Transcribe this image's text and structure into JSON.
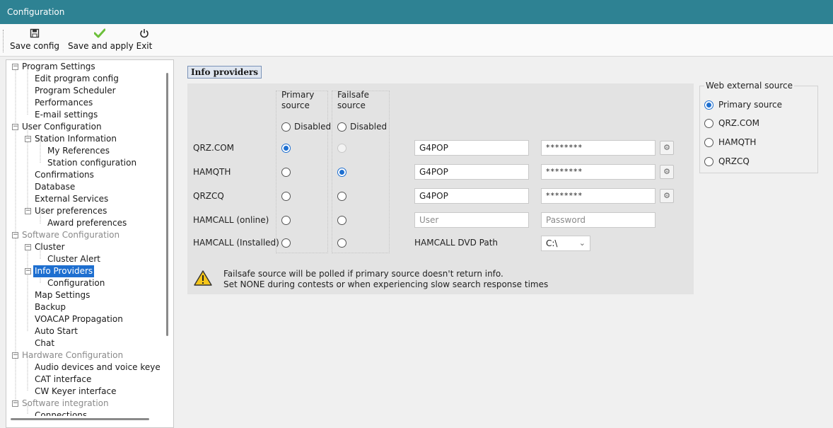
{
  "window": {
    "title": "Configuration"
  },
  "toolbar": {
    "save_config": "Save config",
    "save_apply": "Save and apply",
    "exit": "Exit",
    "save_icon": "floppy-icon",
    "apply_icon": "checkmark-icon",
    "exit_icon": "power-icon"
  },
  "tree": {
    "n0": "Program Settings",
    "n1": "Edit program config",
    "n2": "Program Scheduler",
    "n3": "Performances",
    "n4": "E-mail settings",
    "n5": "User Configuration",
    "n6": "Station Information",
    "n7": "My References",
    "n8": "Station configuration",
    "n9": "Confirmations",
    "n10": "Database",
    "n11": "External Services",
    "n12": "User preferences",
    "n13": "Award preferences",
    "n14": "Software Configuration",
    "n15": "Cluster",
    "n16": "Cluster Alert",
    "n17": "Info Providers",
    "n18": "Configuration",
    "n19": "Map Settings",
    "n20": "Backup",
    "n21": "VOACAP Propagation",
    "n22": "Auto Start",
    "n23": "Chat",
    "n24": "Hardware Configuration",
    "n25": "Audio devices and voice keye",
    "n26": "CAT interface",
    "n27": "CW Keyer interface",
    "n28": "Software integration",
    "n29": "Connections"
  },
  "info": {
    "title": "Info providers",
    "primary_header_1": "Primary",
    "primary_header_2": "source",
    "failsafe_header_1": "Failsafe",
    "failsafe_header_2": "source",
    "disabled": "Disabled",
    "rows": [
      {
        "label": "QRZ.COM",
        "user": "G4POP",
        "password": "********",
        "primary": true,
        "failsafe": false,
        "failsafe_disabled": true
      },
      {
        "label": "HAMQTH",
        "user": "G4POP",
        "password": "********",
        "primary": false,
        "failsafe": true
      },
      {
        "label": "QRZCQ",
        "user": "G4POP",
        "password": "********",
        "primary": false,
        "failsafe": false
      },
      {
        "label": "HAMCALL (online)",
        "user_placeholder": "User",
        "password_placeholder": "Password",
        "primary": false,
        "failsafe": false
      },
      {
        "label": "HAMCALL (Installed)",
        "primary": false,
        "failsafe": false
      }
    ],
    "dvd_path_label": "HAMCALL DVD Path",
    "dvd_path_value": "C:\\",
    "warning_line1": "Failsafe source will be polled if primary source doesn't return info.",
    "warning_line2": "Set NONE during contests or when experiencing slow search response times",
    "warning_icon": "warning-triangle-icon"
  },
  "web_source": {
    "legend": "Web external source",
    "options": [
      "Primary source",
      "QRZ.COM",
      "HAMQTH",
      "QRZCQ"
    ],
    "selected": "Primary source"
  },
  "colors": {
    "titlebar": "#2e8293",
    "selection": "#1e6fd0",
    "panel": "#e3e3e3"
  }
}
